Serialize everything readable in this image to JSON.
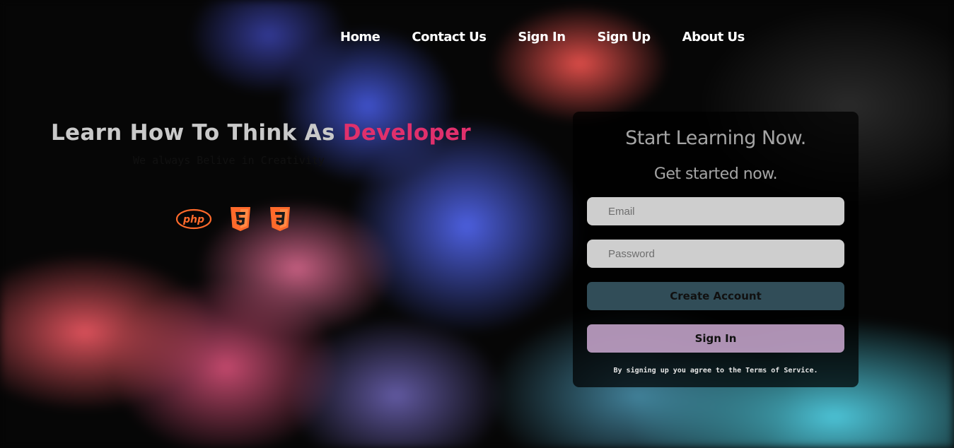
{
  "nav": {
    "items": [
      {
        "label": "Home"
      },
      {
        "label": "Contact Us"
      },
      {
        "label": "Sign In"
      },
      {
        "label": "Sign Up"
      },
      {
        "label": "About Us"
      }
    ]
  },
  "hero": {
    "title_prefix": "Learn How To Think As ",
    "title_accent": "Developer",
    "subtitle": "We always Belive in Creativity",
    "icons": [
      "php-icon",
      "html5-icon",
      "css3-icon"
    ],
    "icon_color": "#ff6a2b",
    "accent_color": "#e0306c"
  },
  "signup": {
    "heading": "Start Learning Now.",
    "subheading": "Get started now.",
    "email_placeholder": "Email",
    "password_placeholder": "Password",
    "create_label": "Create Account",
    "signin_label": "Sign In",
    "terms": "By signing up you agree to the Terms of Service."
  }
}
